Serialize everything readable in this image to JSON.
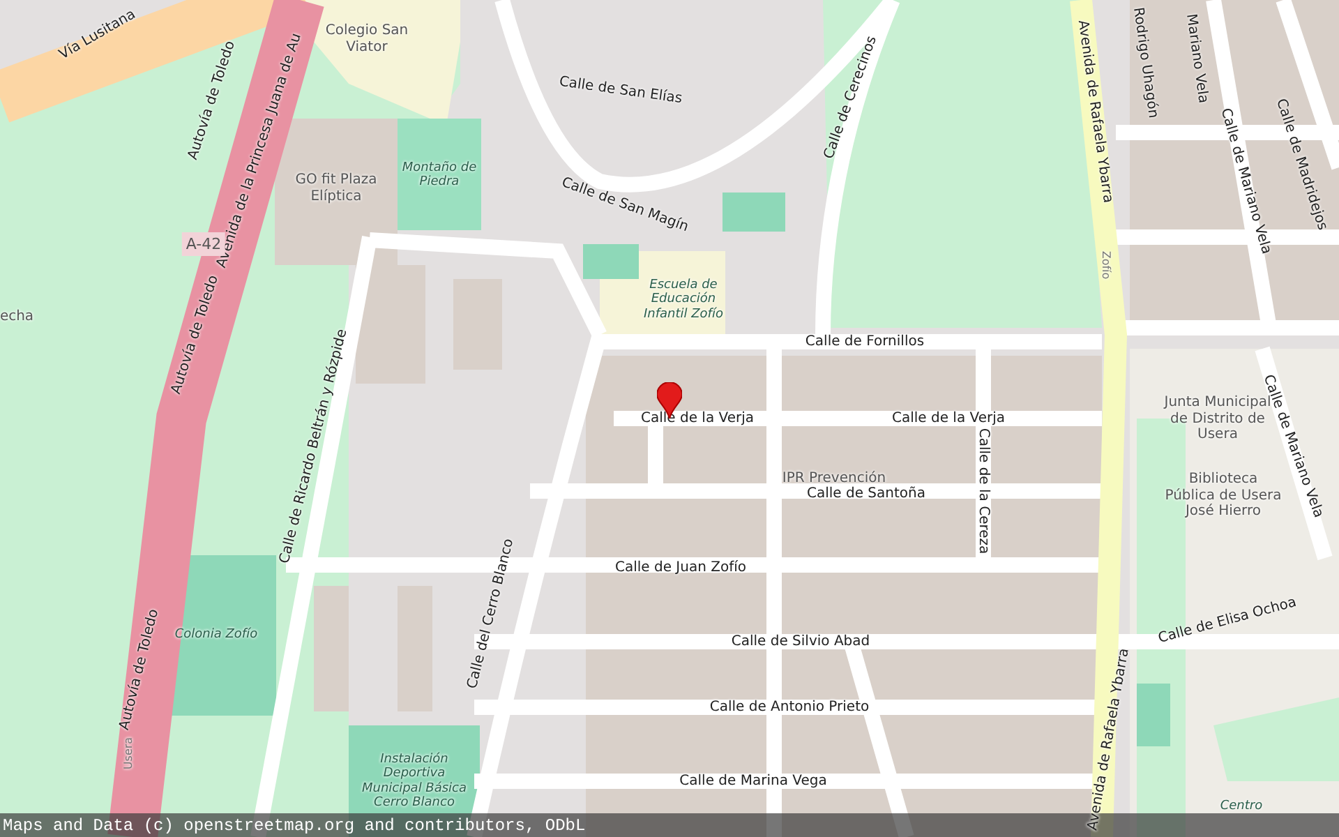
{
  "map": {
    "labels": [
      {
        "text": "Vía Lusitana",
        "kind": "street"
      },
      {
        "text": "Autovía de Toledo",
        "kind": "street"
      },
      {
        "text": "Avenida de la Princesa Juana de Au",
        "kind": "street"
      },
      {
        "text": "A-42",
        "kind": "shield"
      },
      {
        "text": "Autovía de Toledo",
        "kind": "street"
      },
      {
        "text": "Autovía de Toledo",
        "kind": "street"
      },
      {
        "text": "Colegio San Viator",
        "kind": "place"
      },
      {
        "text": "GO fit Plaza Elíptica",
        "kind": "place"
      },
      {
        "text": "Montaño de Piedra",
        "kind": "area"
      },
      {
        "text": "Calle de San Elías",
        "kind": "street"
      },
      {
        "text": "Calle de San Magín",
        "kind": "street"
      },
      {
        "text": "Calle de Cerecinos",
        "kind": "street"
      },
      {
        "text": "Escuela de Educación Infantil Zofío",
        "kind": "area"
      },
      {
        "text": "Calle de Fornillos",
        "kind": "street"
      },
      {
        "text": "Calle de la Verja",
        "kind": "street"
      },
      {
        "text": "Calle de la Verja",
        "kind": "street"
      },
      {
        "text": "IPR Prevención",
        "kind": "place"
      },
      {
        "text": "Calle de Santoña",
        "kind": "street"
      },
      {
        "text": "Calle de la Cereza",
        "kind": "street"
      },
      {
        "text": "Calle de Juan Zofío",
        "kind": "street"
      },
      {
        "text": "Calle de Silvio Abad",
        "kind": "street"
      },
      {
        "text": "Calle de Antonio Prieto",
        "kind": "street"
      },
      {
        "text": "Calle de Marina Vega",
        "kind": "street"
      },
      {
        "text": "Calle del Cerro Blanco",
        "kind": "street"
      },
      {
        "text": "Calle de Ricardo Beltrán y Rózpide",
        "kind": "street"
      },
      {
        "text": "Colonia Zofío",
        "kind": "area"
      },
      {
        "text": "Instalación Deportiva Municipal Básica Cerro Blanco",
        "kind": "area"
      },
      {
        "text": "Avenida de Rafaela Ybarra",
        "kind": "street"
      },
      {
        "text": "Avenida de Rafaela Ybarra",
        "kind": "street"
      },
      {
        "text": "Rodrigo Uhagón",
        "kind": "street"
      },
      {
        "text": "Mariano Vela",
        "kind": "street"
      },
      {
        "text": "Calle de Mariano Vela",
        "kind": "street"
      },
      {
        "text": "Calle de Madridejos",
        "kind": "street"
      },
      {
        "text": "Junta Municipal de Distrito de Usera",
        "kind": "place"
      },
      {
        "text": "Biblioteca Pública de Usera José Hierro",
        "kind": "place"
      },
      {
        "text": "Calle de Mariano Vela",
        "kind": "street"
      },
      {
        "text": "Calle de Elisa Ochoa",
        "kind": "street"
      },
      {
        "text": "Zofío",
        "kind": "small"
      },
      {
        "text": "Usera",
        "kind": "small"
      },
      {
        "text": "echa",
        "kind": "place"
      },
      {
        "text": "Centro",
        "kind": "area"
      }
    ]
  },
  "attribution": "Maps and Data (c) openstreetmap.org and contributors, ODbL"
}
